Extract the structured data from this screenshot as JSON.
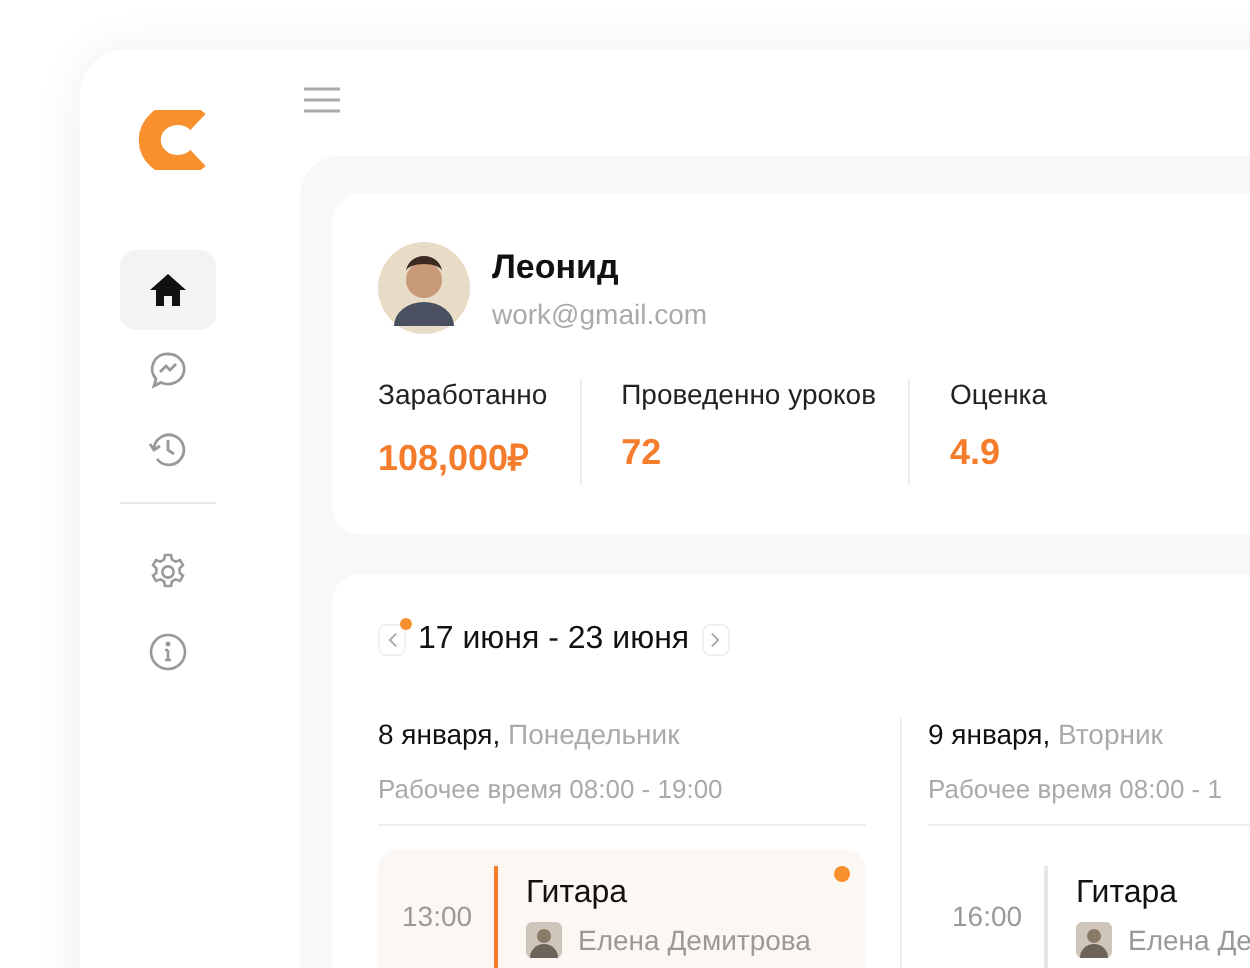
{
  "nav": [
    {
      "kind": "home",
      "selected": true
    },
    {
      "kind": "chat",
      "selected": false
    },
    {
      "kind": "history",
      "selected": false
    },
    {
      "kind": "settings",
      "selected": false
    },
    {
      "kind": "info",
      "selected": false
    }
  ],
  "profile": {
    "name": "Леонид",
    "email": "work@gmail.com"
  },
  "stats": [
    {
      "label": "Заработанно",
      "value": "108,000₽"
    },
    {
      "label": "Проведенно уроков",
      "value": "72"
    },
    {
      "label": "Оценка",
      "value": "4.9"
    }
  ],
  "week": {
    "label": "17 июня - 23 июня",
    "dot": true
  },
  "days": [
    {
      "date": "8 января,",
      "weekday": "Понедельник",
      "hours": "Рабочее время 08:00 - 19:00",
      "lessons": [
        {
          "time": "13:00",
          "title": "Гитара",
          "student": "Елена Демитрова",
          "selected": true
        }
      ]
    },
    {
      "date": "9 января,",
      "weekday": "Вторник",
      "hours": "Рабочее время 08:00 - 1",
      "lessons": [
        {
          "time": "16:00",
          "title": "Гитара",
          "student": "Елена Де",
          "selected": false
        }
      ]
    }
  ]
}
